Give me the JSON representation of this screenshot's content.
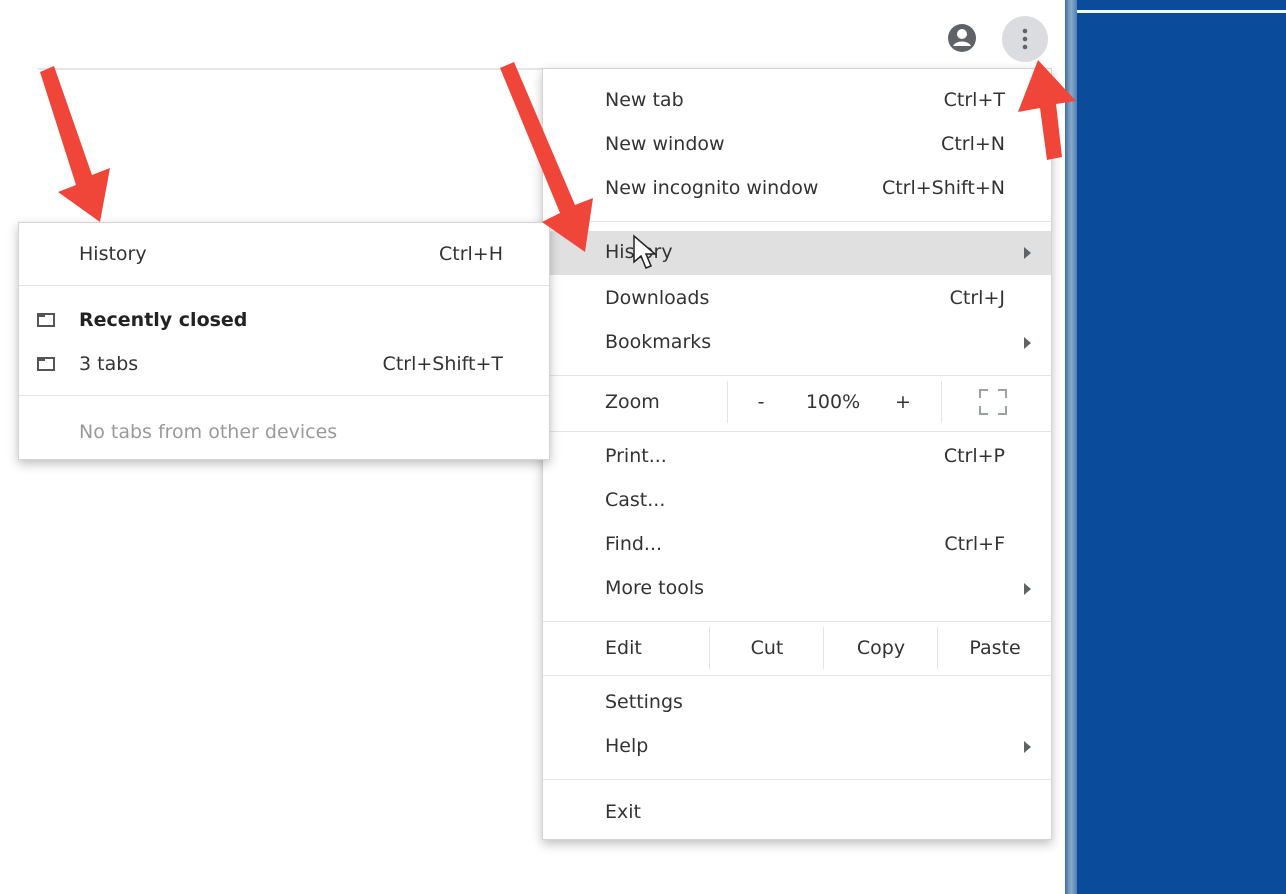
{
  "toolbar": {
    "profile_icon": "account-circle-icon",
    "menu_icon": "more-vert-icon"
  },
  "menu": {
    "items": [
      {
        "label": "New tab",
        "shortcut": "Ctrl+T"
      },
      {
        "label": "New window",
        "shortcut": "Ctrl+N"
      },
      {
        "label": "New incognito window",
        "shortcut": "Ctrl+Shift+N"
      },
      {
        "label": "History",
        "shortcut": ""
      },
      {
        "label": "Downloads",
        "shortcut": "Ctrl+J"
      },
      {
        "label": "Bookmarks",
        "shortcut": ""
      }
    ],
    "zoom": {
      "label": "Zoom",
      "minus": "-",
      "level": "100%",
      "plus": "+"
    },
    "items2": [
      {
        "label": "Print...",
        "shortcut": "Ctrl+P"
      },
      {
        "label": "Cast...",
        "shortcut": ""
      },
      {
        "label": "Find...",
        "shortcut": "Ctrl+F"
      },
      {
        "label": "More tools",
        "shortcut": ""
      }
    ],
    "edit": {
      "label": "Edit",
      "cut": "Cut",
      "copy": "Copy",
      "paste": "Paste"
    },
    "items3": [
      {
        "label": "Settings"
      },
      {
        "label": "Help"
      }
    ],
    "exit": "Exit"
  },
  "history_submenu": {
    "history": {
      "label": "History",
      "shortcut": "Ctrl+H"
    },
    "recently_closed": "Recently closed",
    "tabs": {
      "label": "3 tabs",
      "shortcut": "Ctrl+Shift+T"
    },
    "no_tabs": "No tabs from other devices"
  },
  "colors": {
    "arrow": "#f0463a",
    "desktop": "#0b4b9c",
    "highlight": "#e0e0e0"
  }
}
